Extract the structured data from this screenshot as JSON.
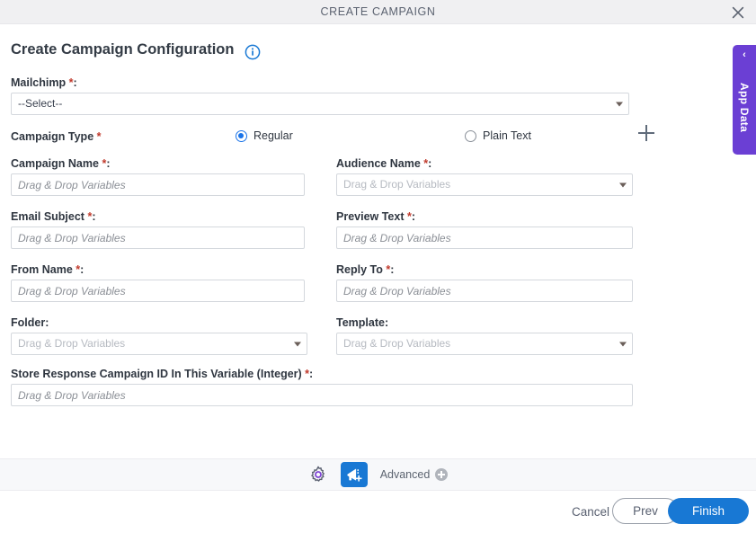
{
  "window": {
    "title": "CREATE CAMPAIGN",
    "close_icon": "close-icon"
  },
  "page": {
    "heading": "Create Campaign Configuration",
    "info_icon": "info-icon"
  },
  "colors": {
    "accent_blue": "#1878d4",
    "radio_blue": "#1a73e8",
    "required_red": "#c0392b",
    "app_data_purple": "#6b3fd4",
    "gear_purple": "#7b3fd4",
    "titlebar_bg": "#f0f0f2",
    "toolbar_bg": "#f7f8fa"
  },
  "form": {
    "mailchimp": {
      "label": "Mailchimp",
      "required": "*",
      "colon": ":",
      "value": "--Select--",
      "add_icon": "plus-icon"
    },
    "campaign_type": {
      "label": "Campaign Type",
      "required": "*",
      "options": [
        {
          "label": "Regular",
          "selected": true
        },
        {
          "label": "Plain Text",
          "selected": false
        }
      ]
    },
    "campaign_name": {
      "label": "Campaign Name",
      "required": "*",
      "colon": ":",
      "placeholder": "Drag & Drop Variables",
      "value": ""
    },
    "audience_name": {
      "label": "Audience Name",
      "required": "*",
      "colon": ":",
      "placeholder": "Drag & Drop Variables",
      "value": "Drag & Drop Variables"
    },
    "email_subject": {
      "label": "Email Subject",
      "required": "*",
      "colon": ":",
      "placeholder": "Drag & Drop Variables",
      "value": ""
    },
    "preview_text": {
      "label": "Preview Text",
      "required": "*",
      "colon": ":",
      "placeholder": "Drag & Drop Variables",
      "value": ""
    },
    "from_name": {
      "label": "From Name",
      "required": "*",
      "colon": ":",
      "placeholder": "Drag & Drop Variables",
      "value": ""
    },
    "reply_to": {
      "label": "Reply To",
      "required": "*",
      "colon": ":",
      "placeholder": "Drag & Drop Variables",
      "value": ""
    },
    "folder": {
      "label": "Folder",
      "required": "",
      "colon": ":",
      "placeholder": "Drag & Drop Variables",
      "value": "Drag & Drop Variables"
    },
    "template": {
      "label": "Template",
      "required": "",
      "colon": ":",
      "placeholder": "Drag & Drop Variables",
      "value": "Drag & Drop Variables"
    },
    "store_response": {
      "label": "Store Response Campaign ID In This Variable (Integer)",
      "required": "*",
      "colon": ":",
      "placeholder": "Drag & Drop Variables",
      "value": ""
    }
  },
  "toolbar": {
    "gear_icon": "gear-icon",
    "campaign_icon": "megaphone-add-icon",
    "advanced_label": "Advanced",
    "advanced_plus_icon": "plus-circle-icon"
  },
  "footer": {
    "cancel_label": "Cancel",
    "prev_label": "Prev",
    "finish_label": "Finish"
  },
  "app_data_panel": {
    "label": "App Data",
    "chevron": "‹",
    "chevron_icon": "chevron-left-icon"
  }
}
